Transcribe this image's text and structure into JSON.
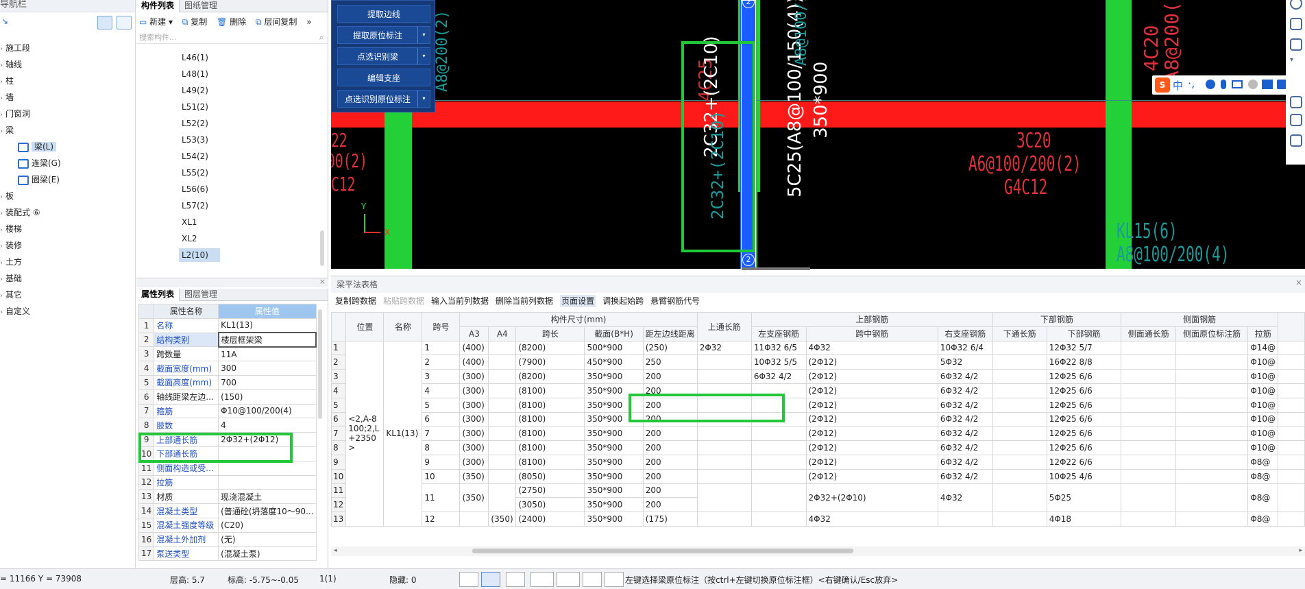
{
  "nav": {
    "title": "导航栏",
    "items": [
      {
        "label": "施工段"
      },
      {
        "label": "轴线"
      },
      {
        "label": "柱"
      },
      {
        "label": "墙"
      },
      {
        "label": "门窗洞"
      },
      {
        "label": "梁"
      },
      {
        "label": "板"
      },
      {
        "label": "装配式 ⑥"
      },
      {
        "label": "楼梯"
      },
      {
        "label": "装修"
      },
      {
        "label": "土方"
      },
      {
        "label": "基础"
      },
      {
        "label": "其它"
      },
      {
        "label": "自定义"
      }
    ],
    "beam_children": [
      {
        "label": "梁(L)"
      },
      {
        "label": "连梁(G)"
      },
      {
        "label": "圈梁(E)"
      }
    ]
  },
  "component_list": {
    "tabs": [
      "构件列表",
      "图纸管理"
    ],
    "toolbar": {
      "new": "新建",
      "copy": "复制",
      "delete": "删除",
      "floor_copy": "层间复制",
      "more": "»"
    },
    "search_placeholder": "搜索构件...",
    "items": [
      "L46(1)",
      "L48(1)",
      "L49(2)",
      "L51(2)",
      "L52(2)",
      "L53(3)",
      "L54(2)",
      "L55(2)",
      "L56(6)",
      "L57(2)",
      "XL1",
      "XL2",
      "L2(10)"
    ],
    "selected": "L2(10)"
  },
  "properties": {
    "tabs": [
      "属性列表",
      "图层管理"
    ],
    "headers": [
      "属性名称",
      "属性值"
    ],
    "rows": [
      {
        "n": "1",
        "k": "名称",
        "v": "KL1(13)",
        "blue": true
      },
      {
        "n": "2",
        "k": "结构类别",
        "v": "楼层框架梁",
        "blue": true
      },
      {
        "n": "3",
        "k": "跨数量",
        "v": "11A",
        "blue": false
      },
      {
        "n": "4",
        "k": "截面宽度(mm)",
        "v": "300",
        "blue": true
      },
      {
        "n": "5",
        "k": "截面高度(mm)",
        "v": "700",
        "blue": true
      },
      {
        "n": "6",
        "k": "轴线距梁左边...",
        "v": "(150)",
        "blue": false
      },
      {
        "n": "7",
        "k": "箍筋",
        "v": "Φ10@100/200(4)",
        "blue": true
      },
      {
        "n": "8",
        "k": "肢数",
        "v": "4",
        "blue": true
      },
      {
        "n": "9",
        "k": "上部通长筋",
        "v": "2Φ32+(2Φ12)",
        "blue": true
      },
      {
        "n": "10",
        "k": "下部通长筋",
        "v": "",
        "blue": true
      },
      {
        "n": "11",
        "k": "侧面构造或受...",
        "v": "",
        "blue": true
      },
      {
        "n": "12",
        "k": "拉筋",
        "v": "",
        "blue": true
      },
      {
        "n": "13",
        "k": "材质",
        "v": "现浇混凝土",
        "blue": false
      },
      {
        "n": "14",
        "k": "混凝土类型",
        "v": "(普通砼(坍落度10～90...",
        "blue": true
      },
      {
        "n": "15",
        "k": "混凝土强度等级",
        "v": "(C20)",
        "blue": true
      },
      {
        "n": "16",
        "k": "混凝土外加剂",
        "v": "(无)",
        "blue": true
      },
      {
        "n": "17",
        "k": "泵送类型",
        "v": "(混凝土泵)",
        "blue": true
      }
    ]
  },
  "popup": {
    "buttons": [
      {
        "label": "提取边线",
        "dropdown": false
      },
      {
        "label": "提取原位标注",
        "dropdown": true
      },
      {
        "label": "点选识别梁",
        "dropdown": true
      },
      {
        "label": "编辑支座",
        "dropdown": false
      },
      {
        "label": "点选识别原位标注",
        "dropdown": true
      }
    ]
  },
  "canvas": {
    "texts": {
      "t1": "A8@200(2)",
      "t2": "22",
      "t3": "00(2)",
      "t4": "C12",
      "t5": "4C25",
      "t6": "2C32+(2C10)",
      "t7": "2C32+(2C10)",
      "t8": "5C25(A8@100/150(4))",
      "t9": "350*900",
      "t10": "A8@100/150(4)",
      "t11": "5C25",
      "t12": "3C20",
      "t13": "A6@100/200(2)",
      "t14": "G4C12",
      "t15": "4C20",
      "t16": "A8@200(2)",
      "t17": "KL15(6)",
      "t18": "A8@100/200(4)",
      "axis_top": "2",
      "axis_bot": "2",
      "ax_y": "Y",
      "ax_x": "X"
    },
    "ime": {
      "label": "中",
      "chars": "·,"
    }
  },
  "grid": {
    "title": "梁平法表格",
    "toolbar": [
      "复制跨数据",
      "粘贴跨数据",
      "输入当前列数据",
      "删除当前列数据",
      "页面设置",
      "调换起始跨",
      "悬臂钢筋代号"
    ],
    "head1": {
      "pos": "位置",
      "name": "名称",
      "span": "跨号",
      "dims": "构件尺寸(mm)",
      "top_long": "上通长筋",
      "top": "上部钢筋",
      "bot": "下部钢筋",
      "side": "侧面钢筋"
    },
    "head2": [
      "A3",
      "A4",
      "跨长",
      "截面(B*H)",
      "距左边线距离",
      "左支座钢筋",
      "跨中钢筋",
      "右支座钢筋",
      "下通长筋",
      "下部钢筋",
      "侧面通长筋",
      "侧面原位标注筋",
      "拉筋"
    ],
    "location": "<2,A-8100;2,L+2350>",
    "name": "KL1(13)",
    "rows": [
      {
        "n": "1",
        "span": "1",
        "a3": "(400)",
        "a4": "",
        "len": "(8200)",
        "sec": "500*900",
        "dist": "(250)",
        "tl": "2Φ32",
        "ls": "11Φ32 6/5",
        "mid": "4Φ32",
        "rs": "10Φ32 6/4",
        "bl": "",
        "bot": "12Φ32 5/7",
        "sl": "",
        "so": "",
        "tie": "Φ14@"
      },
      {
        "n": "2",
        "span": "2",
        "a3": "(400)",
        "a4": "",
        "len": "(7900)",
        "sec": "450*900",
        "dist": "250",
        "tl": "",
        "ls": "10Φ32 5/5",
        "mid": "(2Φ12)",
        "rs": "5Φ32",
        "bl": "",
        "bot": "16Φ22 8/8",
        "sl": "",
        "so": "",
        "tie": "Φ10@"
      },
      {
        "n": "3",
        "span": "3",
        "a3": "(300)",
        "a4": "",
        "len": "(8200)",
        "sec": "350*900",
        "dist": "200",
        "tl": "",
        "ls": "6Φ32 4/2",
        "mid": "(2Φ12)",
        "rs": "6Φ32 4/2",
        "bl": "",
        "bot": "12Φ25 6/6",
        "sl": "",
        "so": "",
        "tie": "Φ10@"
      },
      {
        "n": "4",
        "span": "4",
        "a3": "(300)",
        "a4": "",
        "len": "(8100)",
        "sec": "350*900",
        "dist": "200",
        "tl": "",
        "ls": "",
        "mid": "(2Φ12)",
        "rs": "6Φ32 4/2",
        "bl": "",
        "bot": "12Φ25 6/6",
        "sl": "",
        "so": "",
        "tie": "Φ10@"
      },
      {
        "n": "5",
        "span": "5",
        "a3": "(300)",
        "a4": "",
        "len": "(8100)",
        "sec": "350*900",
        "dist": "200",
        "tl": "",
        "ls": "",
        "mid": "(2Φ12)",
        "rs": "6Φ32 4/2",
        "bl": "",
        "bot": "12Φ25 6/6",
        "sl": "",
        "so": "",
        "tie": "Φ10@"
      },
      {
        "n": "6",
        "span": "6",
        "a3": "(300)",
        "a4": "",
        "len": "(8100)",
        "sec": "350*900",
        "dist": "200",
        "tl": "",
        "ls": "",
        "mid": "(2Φ12)",
        "rs": "6Φ32 4/2",
        "bl": "",
        "bot": "12Φ25 6/6",
        "sl": "",
        "so": "",
        "tie": "Φ10@"
      },
      {
        "n": "7",
        "span": "7",
        "a3": "(300)",
        "a4": "",
        "len": "(8100)",
        "sec": "350*900",
        "dist": "200",
        "tl": "",
        "ls": "",
        "mid": "(2Φ12)",
        "rs": "6Φ32 4/2",
        "bl": "",
        "bot": "12Φ25 6/6",
        "sl": "",
        "so": "",
        "tie": "Φ10@"
      },
      {
        "n": "8",
        "span": "8",
        "a3": "(300)",
        "a4": "",
        "len": "(8100)",
        "sec": "350*900",
        "dist": "200",
        "tl": "",
        "ls": "",
        "mid": "(2Φ12)",
        "rs": "6Φ32 4/2",
        "bl": "",
        "bot": "12Φ25 6/6",
        "sl": "",
        "so": "",
        "tie": "Φ10@"
      },
      {
        "n": "9",
        "span": "9",
        "a3": "(300)",
        "a4": "",
        "len": "(8100)",
        "sec": "350*900",
        "dist": "200",
        "tl": "",
        "ls": "",
        "mid": "(2Φ12)",
        "rs": "6Φ32 4/2",
        "bl": "",
        "bot": "12Φ22 6/6",
        "sl": "",
        "so": "",
        "tie": "Φ8@"
      },
      {
        "n": "10",
        "span": "10",
        "a3": "(350)",
        "a4": "",
        "len": "(8050)",
        "sec": "350*900",
        "dist": "200",
        "tl": "",
        "ls": "",
        "mid": "(2Φ12)",
        "rs": "6Φ32 4/2",
        "bl": "",
        "bot": "10Φ25 4/6",
        "sl": "",
        "so": "",
        "tie": "Φ8@"
      }
    ],
    "row11": {
      "n": "11",
      "span": "11",
      "a3": "(350)",
      "len": "(2750)",
      "sec": "350*900",
      "dist": "200",
      "mid": "2Φ32+(2Φ10)",
      "rs": "4Φ32",
      "bot": "5Φ25",
      "tie": "Φ8@"
    },
    "row12": {
      "n": "12",
      "len": "(3050)",
      "sec": "350*900",
      "dist": "200"
    },
    "row13": {
      "n": "13",
      "span": "12",
      "a4": "(350)",
      "len": "(2400)",
      "sec": "350*900",
      "dist": "(175)",
      "mid": "4Φ32",
      "bot": "4Φ18",
      "tie": "Φ8@"
    }
  },
  "status": {
    "coords": "= 11166 Y = 73908",
    "floor_h": "层高:  5.7",
    "elev": "标高:  -5.75~-0.05",
    "count": "1(1)",
    "hidden": "隐藏:  0",
    "hint": "左键选择梁原位标注（按ctrl+左键切换原位标注框）<右键确认/Esc放弃>"
  },
  "colors": {
    "beam_red": "#ff1a1a",
    "column_green": "#24d038",
    "column_blue": "#1a5cff",
    "highlight_green": "#22c83a",
    "cad_text_red": "#e0303a"
  }
}
